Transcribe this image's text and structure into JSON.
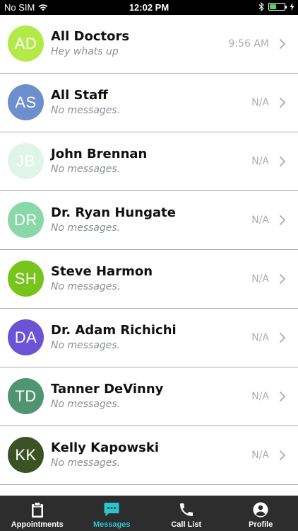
{
  "status_bar": {
    "carrier": "No SIM",
    "time": "12:02 PM"
  },
  "conversations": [
    {
      "initials": "AD",
      "name": "All Doctors",
      "preview": "Hey whats up",
      "time": "9:56 AM",
      "color": "#b3ea4a"
    },
    {
      "initials": "AS",
      "name": "All Staff",
      "preview": "No messages.",
      "time": "N/A",
      "color": "#6e8fce"
    },
    {
      "initials": "JB",
      "name": "John Brennan",
      "preview": "No messages.",
      "time": "N/A",
      "color": "#dff5ea"
    },
    {
      "initials": "DR",
      "name": "Dr. Ryan Hungate",
      "preview": "No messages.",
      "time": "N/A",
      "color": "#8ad8a7"
    },
    {
      "initials": "SH",
      "name": "Steve Harmon",
      "preview": "No messages.",
      "time": "N/A",
      "color": "#77c41b"
    },
    {
      "initials": "DA",
      "name": "Dr. Adam Richichi",
      "preview": "No messages.",
      "time": "N/A",
      "color": "#6b53d6"
    },
    {
      "initials": "TD",
      "name": "Tanner DeVinny",
      "preview": "No messages.",
      "time": "N/A",
      "color": "#4f9572"
    },
    {
      "initials": "KK",
      "name": "Kelly Kapowski",
      "preview": "No messages.",
      "time": "N/A",
      "color": "#3a5224"
    }
  ],
  "tabbar": {
    "active_color": "#2cc3cf",
    "tabs": [
      {
        "label": "Appointments",
        "icon": "clipboard-icon"
      },
      {
        "label": "Messages",
        "icon": "chat-bubble-icon"
      },
      {
        "label": "Call List",
        "icon": "phone-icon"
      },
      {
        "label": "Profile",
        "icon": "user-circle-icon"
      }
    ]
  }
}
